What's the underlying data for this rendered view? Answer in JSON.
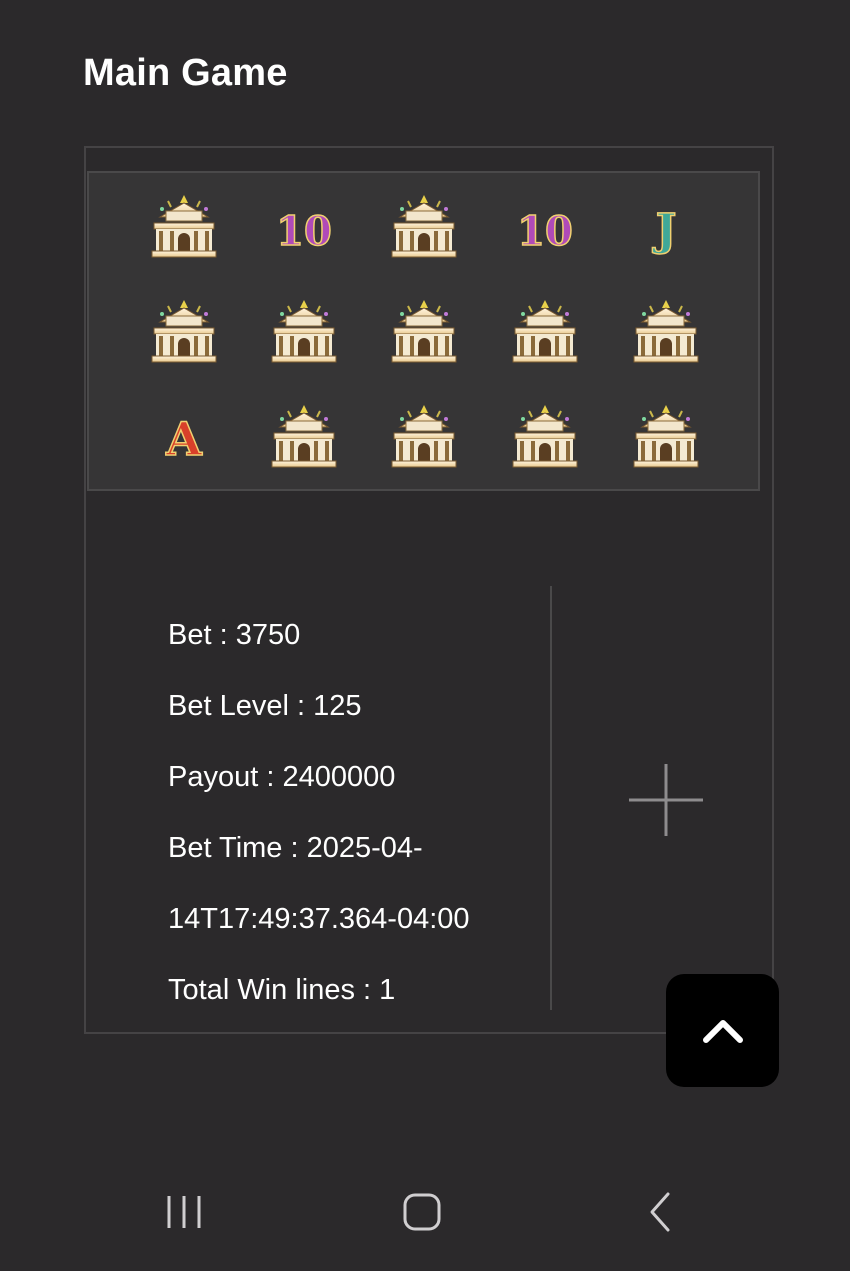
{
  "page": {
    "title": "Main Game"
  },
  "reels": {
    "rows": [
      [
        {
          "symbol": "temple-icon"
        },
        {
          "symbol": "ten-icon",
          "text": "10"
        },
        {
          "symbol": "temple-icon"
        },
        {
          "symbol": "ten-icon",
          "text": "10"
        },
        {
          "symbol": "jack-icon",
          "text": "J"
        }
      ],
      [
        {
          "symbol": "temple-icon"
        },
        {
          "symbol": "temple-icon"
        },
        {
          "symbol": "temple-icon"
        },
        {
          "symbol": "temple-icon"
        },
        {
          "symbol": "temple-icon"
        }
      ],
      [
        {
          "symbol": "ace-icon",
          "text": "A"
        },
        {
          "symbol": "temple-icon"
        },
        {
          "symbol": "temple-icon"
        },
        {
          "symbol": "temple-icon"
        },
        {
          "symbol": "temple-icon"
        }
      ]
    ]
  },
  "details": {
    "bet": "Bet : 3750",
    "bet_level": "Bet Level : 125",
    "payout": "Payout : 2400000",
    "bet_time_1": "Bet Time : 2025-04-",
    "bet_time_2": "14T17:49:37.364-04:00",
    "total_win_lines": "Total Win lines : 1"
  },
  "icons": {
    "expand": "plus-icon",
    "scroll_top": "chevron-up-icon",
    "nav_recents": "recents-icon",
    "nav_home": "home-icon",
    "nav_back": "back-icon"
  },
  "colors": {
    "background": "#2b292b",
    "reel_panel": "#363536",
    "ten_symbol": "#b04ab8",
    "jack_symbol": "#3fa898",
    "ace_symbol": "#d8402a",
    "temple_gold": "#e8c98e"
  }
}
